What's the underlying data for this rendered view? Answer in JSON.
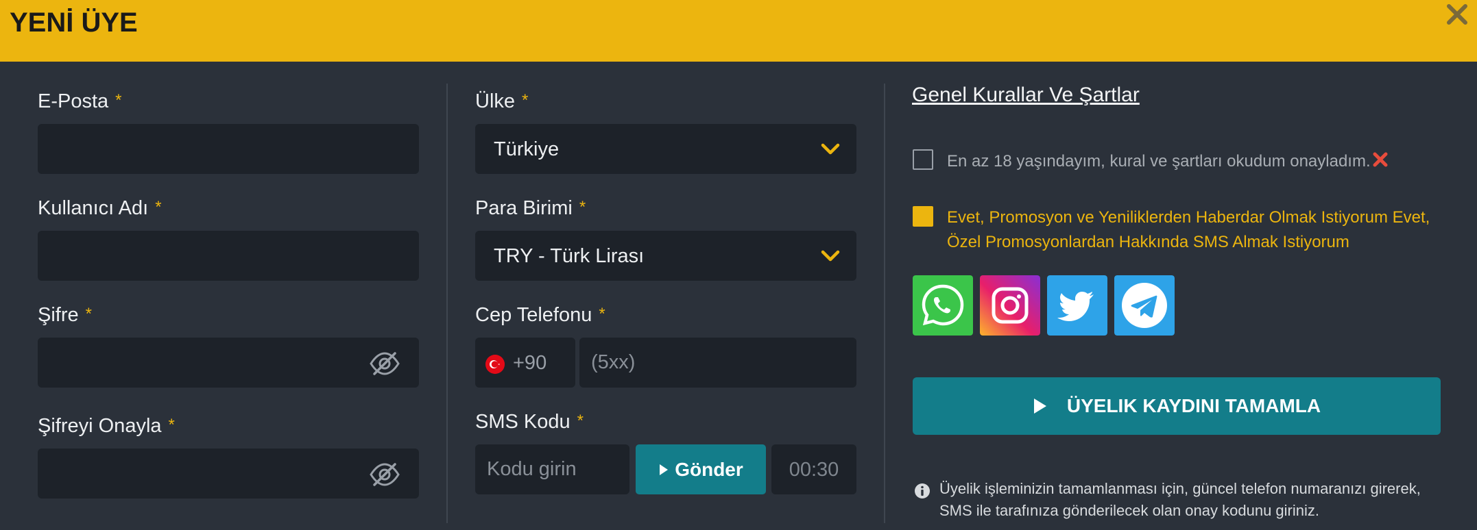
{
  "header": {
    "title": "YENİ ÜYE"
  },
  "form": {
    "email": {
      "label": "E-Posta",
      "required": "*",
      "value": ""
    },
    "username": {
      "label": "Kullanıcı Adı",
      "required": "*",
      "value": ""
    },
    "password": {
      "label": "Şifre",
      "required": "*",
      "value": ""
    },
    "password_confirm": {
      "label": "Şifreyi Onayla",
      "required": "*",
      "value": ""
    },
    "country": {
      "label": "Ülke",
      "required": "*",
      "value": "Türkiye"
    },
    "currency": {
      "label": "Para Birimi",
      "required": "*",
      "value": "TRY - Türk Lirası"
    },
    "phone": {
      "label": "Cep Telefonu",
      "required": "*",
      "country_code": "+90",
      "placeholder": "(5xx)"
    },
    "sms": {
      "label": "SMS Kodu",
      "required": "*",
      "placeholder": "Kodu girin",
      "send_label": "Gönder",
      "timer": "00:30"
    }
  },
  "terms": {
    "rules_link": "Genel Kurallar Ve Şartlar",
    "age_confirm": "En az 18 yaşındayım, kural ve şartları okudum onayladım.",
    "promo_confirm": "Evet, Promosyon ve Yeniliklerden Haberdar Olmak Istiyorum Evet, Özel Promosyonlardan Hakkında SMS Almak Istiyorum"
  },
  "social": [
    "whatsapp-icon",
    "instagram-icon",
    "twitter-icon",
    "telegram-icon"
  ],
  "submit_label": "ÜYELIK KAYDINI TAMAMLA",
  "info_text": "Üyelik işleminizin tamamlanması için, güncel telefon numaranızı girerek, SMS ile tarafınıza gönderilecek olan onay kodunu giriniz.",
  "colors": {
    "accent": "#ecb50f",
    "teal": "#137d8a",
    "background": "#2b313a",
    "field": "#1d2229"
  }
}
